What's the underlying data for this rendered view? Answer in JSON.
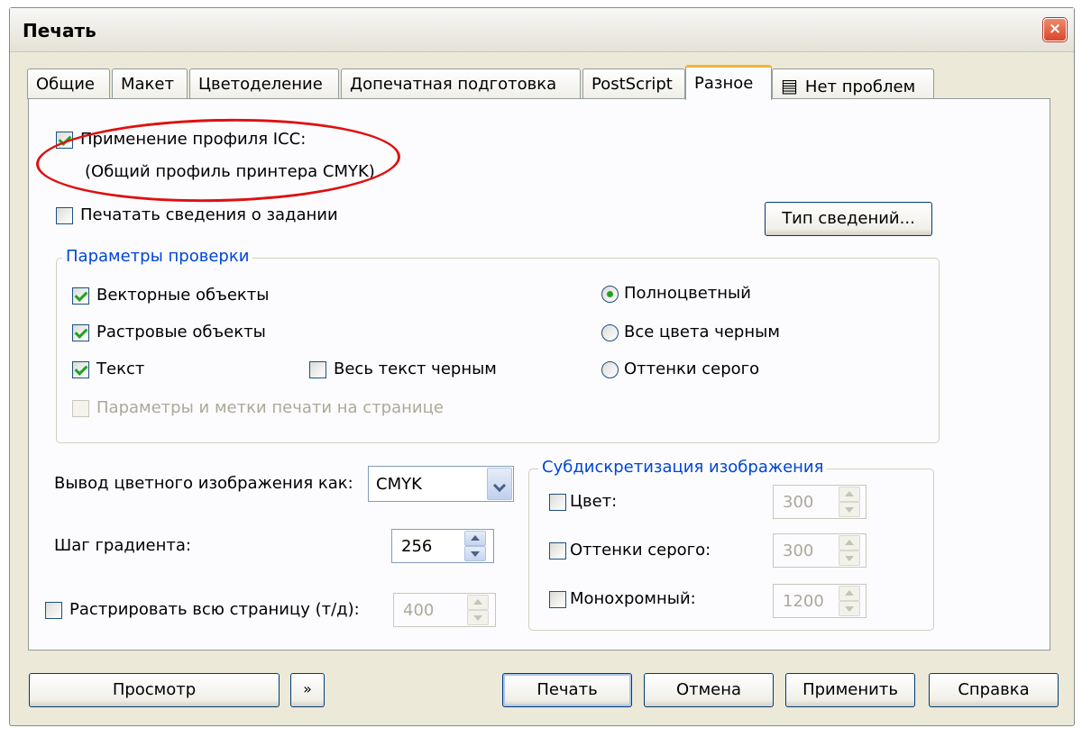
{
  "window": {
    "title": "Печать",
    "close_label": "×"
  },
  "tabs": [
    {
      "label": "Общие"
    },
    {
      "label": "Макет"
    },
    {
      "label": "Цветоделение"
    },
    {
      "label": "Допечатная подготовка"
    },
    {
      "label": "PostScript"
    },
    {
      "label": "Разное",
      "active": true
    },
    {
      "label": "Нет проблем",
      "icon": "document-check-icon"
    }
  ],
  "misc": {
    "icc_profile_label": "Применение профиля ICC:",
    "icc_profile_value": "(Общий профиль принтера CMYK)",
    "print_job_info_label": "Печатать сведения о задании",
    "info_type_button": "Тип сведений...",
    "proof": {
      "legend": "Параметры проверки",
      "vector_label": "Векторные объекты",
      "bitmap_label": "Растровые объекты",
      "text_label": "Текст",
      "all_text_black_label": "Весь текст черным",
      "page_marks_label": "Параметры и метки печати на странице",
      "full_color_label": "Полноцветный",
      "all_black_label": "Все цвета черным",
      "grayscale_label": "Оттенки серого"
    },
    "color_output_label": "Вывод цветного изображения как:",
    "color_output_value": "CMYK",
    "gradient_steps_label": "Шаг градиента:",
    "gradient_steps_value": "256",
    "rasterize_label": "Растрировать всю страницу (т/д):",
    "rasterize_value": "400",
    "downsample": {
      "legend": "Субдискретизация изображения",
      "color_label": "Цвет:",
      "color_value": "300",
      "grayscale_label": "Оттенки серого:",
      "grayscale_value": "300",
      "mono_label": "Монохромный:",
      "mono_value": "1200"
    }
  },
  "footer": {
    "preview_button": "Просмотр",
    "expand_icon": "double-chevron-right-icon",
    "print_button": "Печать",
    "cancel_button": "Отмена",
    "apply_button": "Применить",
    "help_button": "Справка"
  },
  "colors": {
    "dialog_bg": "#ece9d8",
    "panel_bg": "#fcfcfe",
    "legend_blue": "#0046d5",
    "active_tab_accent": "#f5b335",
    "highlight_red": "#dd1111"
  }
}
